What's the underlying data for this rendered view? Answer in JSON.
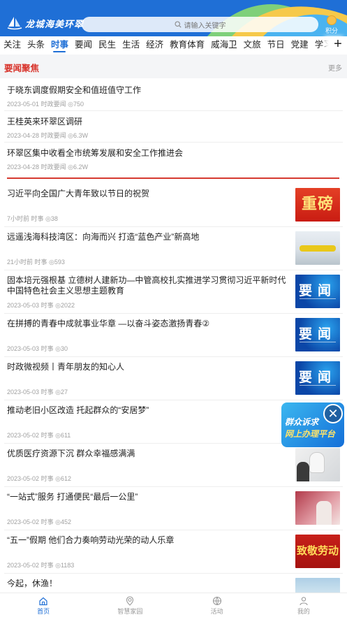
{
  "header": {
    "logo_text": "龙城海美环翠",
    "search_placeholder": "请输入关键字",
    "points_label": "积分",
    "accent": "#1f6fd6"
  },
  "tabs": [
    "关注",
    "头条",
    "时事",
    "要闻",
    "民生",
    "生活",
    "经济",
    "教育体育",
    "威海卫",
    "文旅",
    "节日",
    "党建",
    "学习强国",
    "专"
  ],
  "active_tab": "时事",
  "focus": {
    "title": "要闻聚焦",
    "more": "更多",
    "items": [
      {
        "title": "于晓东调度假期安全和值班值守工作",
        "date": "2023-05-01",
        "source": "时政要闻",
        "views": "750"
      },
      {
        "title": "王桂英来环翠区调研",
        "date": "2023-04-28",
        "source": "时政要闻",
        "views": "6.3W"
      },
      {
        "title": "环翠区集中收看全市统筹发展和安全工作推进会",
        "date": "2023-04-28",
        "source": "时政要闻",
        "views": "6.2W"
      }
    ]
  },
  "news": [
    {
      "title": "习近平向全国广大青年致以节日的祝贺",
      "time": "7小时前",
      "source": "时事",
      "views": "38",
      "thumb": "重磅",
      "thumb_type": "zb"
    },
    {
      "title": "远遥浅海科技湾区：向海而兴  打造“蓝色产业”新高地",
      "time": "21小时前",
      "source": "时事",
      "views": "593",
      "thumb": "",
      "thumb_type": "tech"
    },
    {
      "title": "固本培元强根基  立德树人建新功—中管高校扎实推进学习贯彻习近平新时代中国特色社会主义思想主题教育",
      "time": "2023-05-03",
      "source": "时事",
      "views": "2022",
      "thumb": "要闻",
      "thumb_type": "yw"
    },
    {
      "title": "在拼搏的青春中成就事业华章  —以奋斗姿态激扬青春②",
      "time": "2023-05-03",
      "source": "时事",
      "views": "30",
      "thumb": "要闻",
      "thumb_type": "yw"
    },
    {
      "title": "时政微视频丨青年朋友的知心人",
      "time": "2023-05-03",
      "source": "时事",
      "views": "27",
      "thumb": "要闻",
      "thumb_type": "yw"
    },
    {
      "title": "推动老旧小区改造  托起群众的“安居梦”",
      "time": "2023-05-02",
      "source": "时事",
      "views": "611",
      "thumb": "",
      "thumb_type": "none"
    },
    {
      "title": "优质医疗资源下沉  群众幸福感满满",
      "time": "2023-05-02",
      "source": "时事",
      "views": "612",
      "thumb": "",
      "thumb_type": "med"
    },
    {
      "title": "“一站式”服务  打通便民“最后一公里”",
      "time": "2023-05-02",
      "source": "时事",
      "views": "452",
      "thumb": "",
      "thumb_type": "svc"
    },
    {
      "title": "“五一”假期  他们合力奏响劳动光荣的动人乐章",
      "time": "2023-05-02",
      "source": "时事",
      "views": "1183",
      "thumb": "致敬劳动",
      "thumb_type": "ld"
    },
    {
      "title": "今起，休渔！",
      "time": "",
      "source": "",
      "views": "",
      "thumb": "",
      "thumb_type": "sea"
    }
  ],
  "float_badge": {
    "line1": "群众诉求",
    "line2": "网上办理平台"
  },
  "bottom_nav": [
    {
      "label": "首页",
      "icon": "home-icon",
      "active": true
    },
    {
      "label": "智慧家园",
      "icon": "location-icon",
      "active": false
    },
    {
      "label": "活动",
      "icon": "ball-icon",
      "active": false
    },
    {
      "label": "我的",
      "icon": "user-icon",
      "active": false
    }
  ]
}
